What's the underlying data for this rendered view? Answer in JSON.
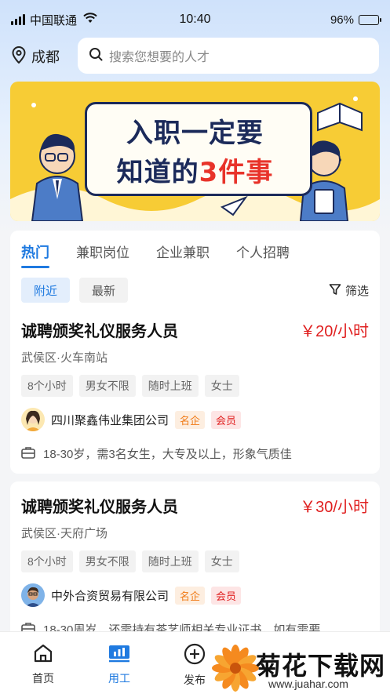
{
  "status_bar": {
    "carrier": "中国联通",
    "time": "10:40",
    "battery": "96%",
    "battery_level": 0.96
  },
  "header": {
    "location": "成都",
    "search_placeholder": "搜索您想要的人才"
  },
  "banner": {
    "line1": "入职一定要",
    "line2_a": "知道的",
    "line2_b": "3件事"
  },
  "tabs": [
    "热门",
    "兼职岗位",
    "企业兼职",
    "个人招聘"
  ],
  "chips": {
    "nearby": "附近",
    "newest": "最新"
  },
  "filter_label": "筛选",
  "jobs": [
    {
      "title": "诚聘颁奖礼仪服务人员",
      "salary": "￥20/小时",
      "location": "武侯区·火车南站",
      "tags": [
        "8个小时",
        "男女不限",
        "随时上班",
        "女士"
      ],
      "company": "四川聚鑫伟业集团公司",
      "badge_famous": "名企",
      "badge_member": "会员",
      "requirement": "18-30岁，需3名女生，大专及以上，形象气质佳"
    },
    {
      "title": "诚聘颁奖礼仪服务人员",
      "salary": "￥30/小时",
      "location": "武侯区·天府广场",
      "tags": [
        "8个小时",
        "男女不限",
        "随时上班",
        "女士"
      ],
      "company": "中外合资贸易有限公司",
      "badge_famous": "名企",
      "badge_member": "会员",
      "requirement": "18-30周岁，还需持有茶艺师相关专业证书，如有需要..."
    }
  ],
  "tabbar": [
    "首页",
    "用工",
    "发布"
  ],
  "watermark": {
    "title": "菊花下载网",
    "url": "www.juahar.com"
  },
  "colors": {
    "accent": "#1f7ae0",
    "salary": "#e02020",
    "banner": "#f7cc35"
  }
}
